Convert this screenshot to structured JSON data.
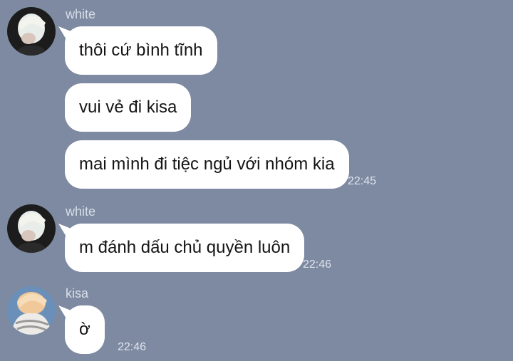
{
  "messages": [
    {
      "sender": "white",
      "avatar": "white-avatar",
      "texts": [
        "thôi cứ bình tĩnh",
        "vui vẻ đi kisa",
        "mai mình đi tiệc ngủ với nhóm kia"
      ],
      "time": "22:45"
    },
    {
      "sender": "white",
      "avatar": "white-avatar",
      "texts": [
        "m đánh dấu chủ quyền luôn"
      ],
      "time": "22:46"
    },
    {
      "sender": "kisa",
      "avatar": "kisa-avatar",
      "texts": [
        "ờ"
      ],
      "time": "22:46"
    }
  ],
  "colors": {
    "background": "#7d8aa1",
    "bubble": "#ffffff",
    "meta_text": "#dfe4ec"
  }
}
